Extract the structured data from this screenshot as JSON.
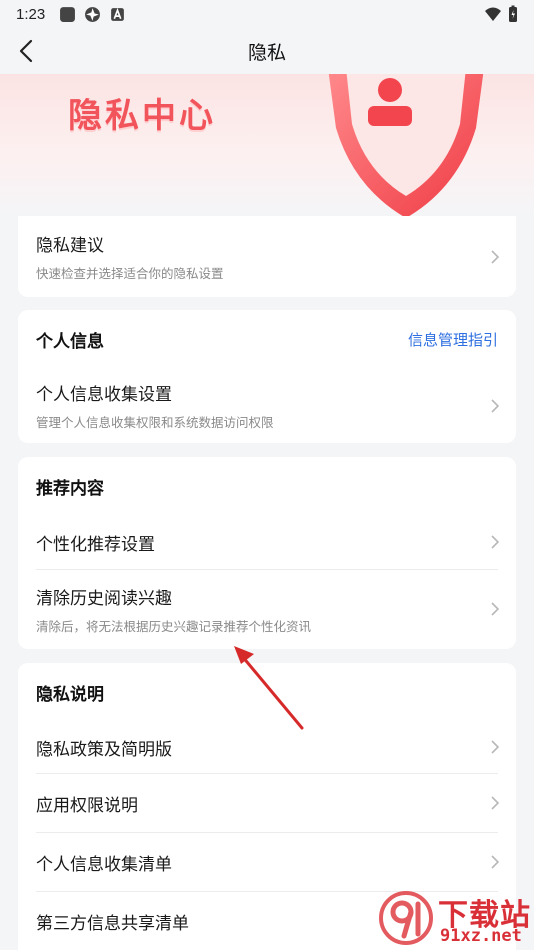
{
  "status_bar": {
    "time": "1:23"
  },
  "header": {
    "title": "隐私"
  },
  "banner": {
    "text": "隐私中心"
  },
  "privacy_suggestion": {
    "title": "隐私建议",
    "subtitle": "快速检查并选择适合你的隐私设置"
  },
  "personal_info": {
    "section_title": "个人信息",
    "link": "信息管理指引",
    "items": [
      {
        "title": "个人信息收集设置",
        "subtitle": "管理个人信息收集权限和系统数据访问权限"
      }
    ]
  },
  "recommend": {
    "section_title": "推荐内容",
    "items": [
      {
        "title": "个性化推荐设置"
      },
      {
        "title": "清除历史阅读兴趣",
        "subtitle": "清除后，将无法根据历史兴趣记录推荐个性化资讯"
      }
    ]
  },
  "privacy_notes": {
    "section_title": "隐私说明",
    "items": [
      {
        "title": "隐私政策及简明版"
      },
      {
        "title": "应用权限说明"
      },
      {
        "title": "个人信息收集清单"
      },
      {
        "title": "第三方信息共享清单"
      }
    ]
  },
  "watermark": {
    "brand": "下载站",
    "domain": "91xz.net"
  },
  "colors": {
    "accent_link": "#2d6fe0",
    "banner_red": "#f2545c",
    "annotation_arrow": "#d62a2a"
  }
}
